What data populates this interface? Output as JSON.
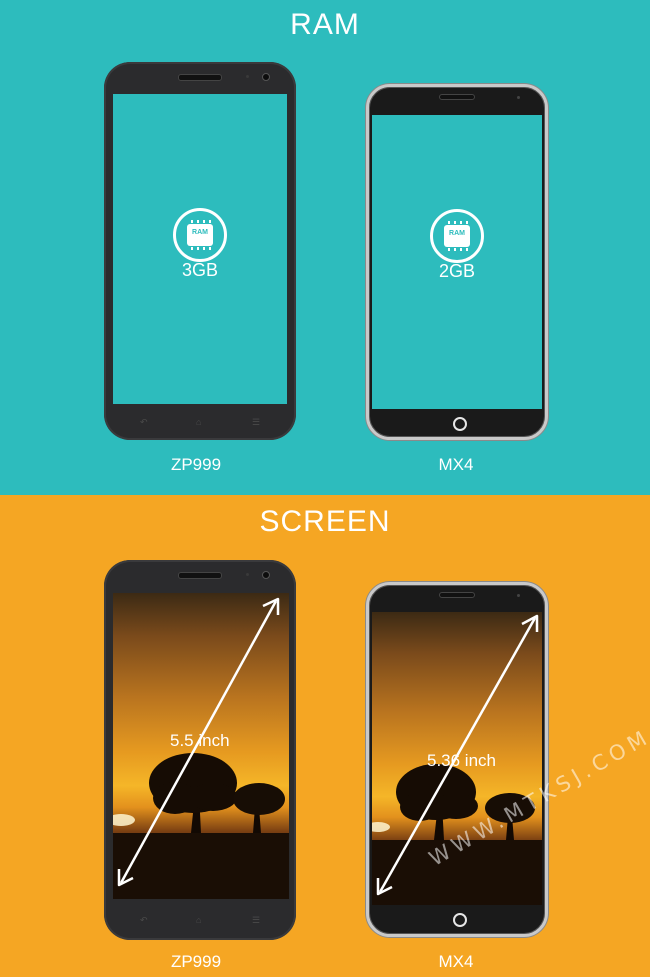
{
  "ram": {
    "title": "RAM",
    "badge_text": "RAM",
    "phones": [
      {
        "name": "ZP999",
        "value": "3GB"
      },
      {
        "name": "MX4",
        "value": "2GB"
      }
    ]
  },
  "screen": {
    "title": "SCREEN",
    "phones": [
      {
        "name": "ZP999",
        "size": "5.5 inch"
      },
      {
        "name": "MX4",
        "size": "5.36 inch"
      }
    ]
  },
  "watermark": "WWW.MTKSJ.COM",
  "colors": {
    "teal_background": "#2dbcbd",
    "orange_background": "#f5a623",
    "zp999_body": "#2b2b2d",
    "mx4_frame": "#c9c9c9"
  }
}
